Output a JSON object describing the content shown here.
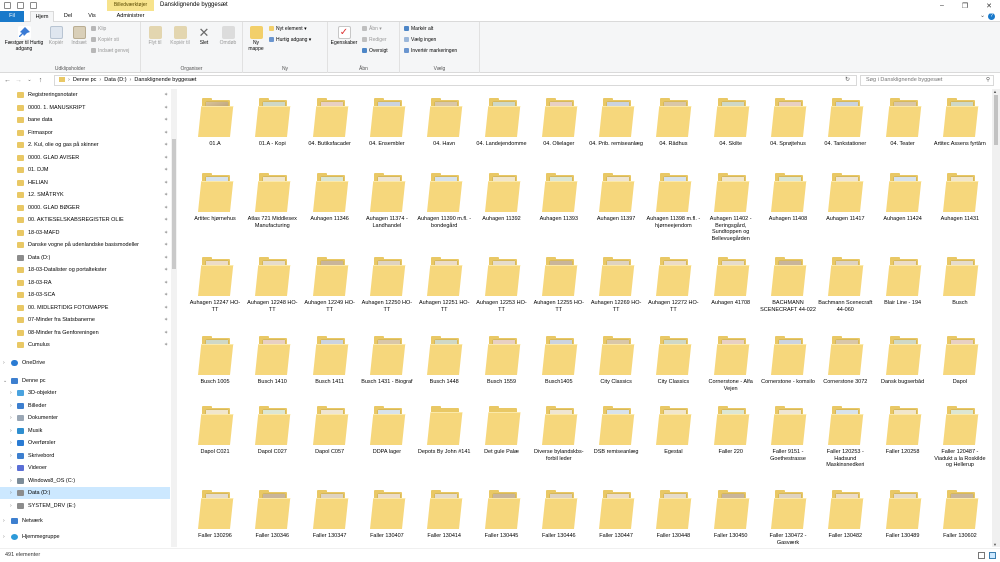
{
  "window": {
    "title": "Dansklignende byggesæt",
    "context_tool_label": "Billedværktøjer"
  },
  "tabs": [
    {
      "label": "Fil"
    },
    {
      "label": "Hjem"
    },
    {
      "label": "Del"
    },
    {
      "label": "Vis"
    },
    {
      "label": "Administrer"
    }
  ],
  "ribbon": {
    "clipboard": {
      "label": "Udklipsholder",
      "pin": "Fæstgør til Hurtig adgang",
      "copy": "Kopiér",
      "paste": "Indsæt",
      "cut": "Klip",
      "copy_path": "Kopiér sti",
      "paste_shortcut": "Indsæt genvej"
    },
    "organize": {
      "label": "Organiser",
      "move_to": "Flyt til",
      "copy_to": "Kopiér til",
      "delete": "Slet",
      "rename": "Omdøb"
    },
    "new": {
      "label": "Ny",
      "new_folder": "Ny mappe",
      "new_item": "Nyt element",
      "easy_access": "Hurtig adgang"
    },
    "open": {
      "label": "Åbn",
      "properties": "Egenskaber",
      "open": "Åbn",
      "edit": "Rediger",
      "history": "Oversigt"
    },
    "select": {
      "label": "Vælg",
      "select_all": "Markér alt",
      "select_none": "Vælg ingen",
      "invert": "Invertér markeringen"
    }
  },
  "address": {
    "crumbs": [
      "Denne pc",
      "Data (D:)",
      "Dansklignende byggesæt"
    ],
    "search_placeholder": "Søg i Dansklignende byggesæt"
  },
  "nav": {
    "quick_access": [
      "Registreringsnotater",
      "0000. 1. MANUSKRIPT",
      "bane data",
      "Firmaspor",
      "2. Kul, olie og gas på skinner",
      "0000. GLAD AVISER",
      "01. DJM",
      "HELIAN",
      "12. SMÅTRYK",
      "0000. GLAD BØGER",
      "00. AKTIESELSKABSREGISTER OLIE",
      "18-03-MAFD",
      "Danske vogne på udenlandske basismodeller",
      "Data (D:)",
      "18-03-Datalister og portaltekster",
      "18-03-RA",
      "18-03-SCA",
      "00. MIDLERTIDIG FOTOMAPPE",
      "07-Minder fra Statsbanerne",
      "08-Minder fra Genforeningen",
      "Cumulus"
    ],
    "onedrive": "OneDrive",
    "this_pc": "Denne pc",
    "pc_items": [
      "3D-objekter",
      "Billeder",
      "Dokumenter",
      "Musik",
      "Overførsler",
      "Skrivebord",
      "Videoer",
      "Windows8_OS (C:)",
      "Data (D:)",
      "SYSTEM_DRV (E:)"
    ],
    "network": "Netværk",
    "homegroup": "Hjemmegruppe"
  },
  "items": [
    [
      "01.A",
      "01.A - Kopi",
      "04. Butiksfacader",
      "04. Ensembler",
      "04. Havn",
      "04. Landejendomme",
      "04. Olielager",
      "04. Prib. remiseanlæg",
      "04. Rådhus",
      "04. Skilte",
      "04. Sprøjtehus",
      "04. Tankstationer",
      "04. Teater",
      "Artitec Assens fyrtårn"
    ],
    [
      "Artitec hjørnehus",
      "Atlas 721 Middlesex Manufacturing",
      "Auhagen 11346",
      "Auhagen 11374 - Landhandel",
      "Auhagen 11390 m.fl. - bondegård",
      "Auhagen 11392",
      "Auhagen 11393",
      "Auhagen 11397",
      "Auhagen 11398 m.fl. - hjørneejendom",
      "Auhagen 11402 - Beringsgård, Sundtoppen og Bellevuegården",
      "Auhagen 11408",
      "Auhagen 11417",
      "Auhagen 11424",
      "Auhagen 11431"
    ],
    [
      "Auhagen 12247 HO-TT",
      "Auhagen 12248 HO-TT",
      "Auhagen 12249 HO-TT",
      "Auhagen 12250 HO-TT",
      "Auhagen 12251 HO-TT",
      "Auhagen 12253 HO-TT",
      "Auhagen 12255 HO-TT",
      "Auhagen 12269 HO-TT",
      "Auhagen 12272 HO-TT",
      "Auhagen 41708",
      "BACHMANN SCENECRAFT 44-022",
      "Bachmann Scenecraft 44-060",
      "Blair Line - 194",
      "Busch"
    ],
    [
      "Busch 1005",
      "Busch 1410",
      "Busch 1411",
      "Busch 1431 - Biograf",
      "Busch 1448",
      "Busch 1559",
      "Busch1405",
      "City Classics",
      "City Classics",
      "Cornerstone - Alfa Vejen",
      "Cornerstone - komsilo",
      "Cornerstone 3072",
      "Dansk bugserbåd",
      "Dapol"
    ],
    [
      "Dapol C021",
      "Dapol C027",
      "Dapol C057",
      "DDPA lager",
      "Depots By John #141",
      "Det gule Palæ",
      "Diverse bylandskbs-forbil leder",
      "DSB remiseanlæg",
      "Egestal",
      "Faller 220",
      "Faller 9151 -Goethestrasse",
      "Faller 120253 - Hadsund Maskinsnedkeri",
      "Faller 120258",
      "Faller 120487 - Viadukt a la Roskilde og Hellerup"
    ],
    [
      "Faller 130296",
      "Faller 130346",
      "Faller 130347",
      "Faller 130407",
      "Faller 130414",
      "Faller 130445",
      "Faller 130446",
      "Faller 130447",
      "Faller 130448",
      "Faller 130450",
      "Faller 130472 - Gasværk",
      "Faller 130482",
      "Faller 130489",
      "Faller 130602"
    ]
  ],
  "status": {
    "count": "491 elementer"
  }
}
